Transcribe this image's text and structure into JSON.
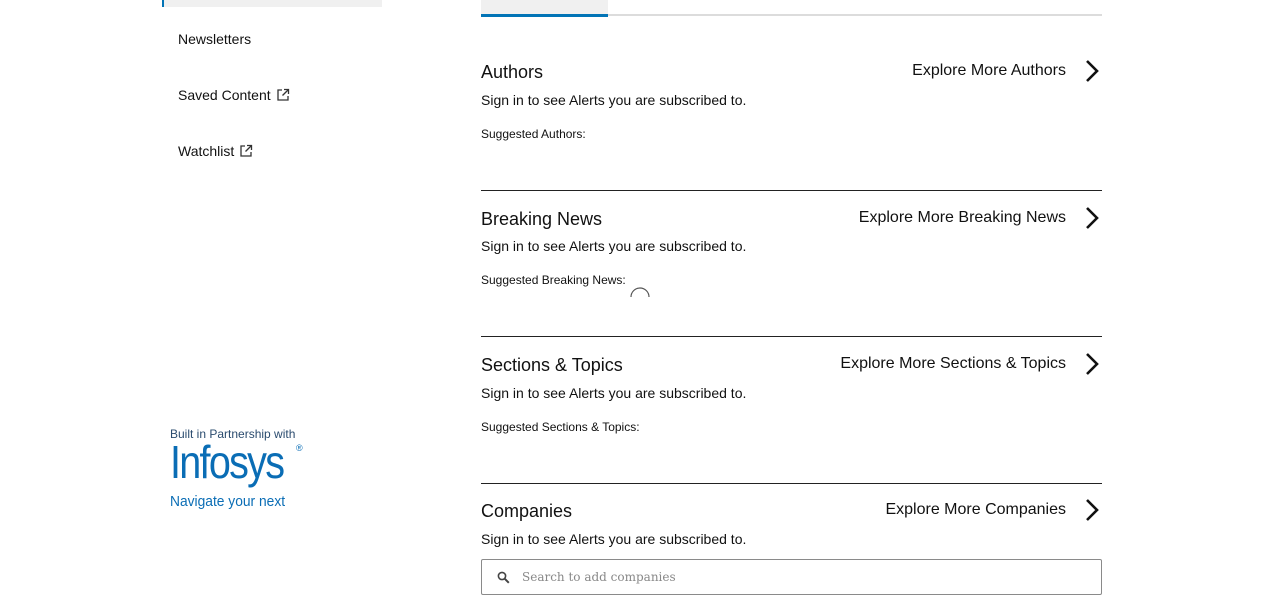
{
  "sidebar": {
    "items": [
      {
        "label": "Newsletters",
        "external": false
      },
      {
        "label": "Saved Content",
        "external": true,
        "icon": "external-link-icon"
      },
      {
        "label": "Watchlist",
        "external": true,
        "icon": "external-link-icon"
      }
    ],
    "partner": {
      "pre_text": "Built in Partnership with",
      "name": "Infosys",
      "registered_mark": "®",
      "tagline": "Navigate your next",
      "brand_color": "#0a6db5"
    }
  },
  "main": {
    "accent_color": "#0274b6",
    "sections": [
      {
        "title": "Authors",
        "explore_label": "Explore More Authors",
        "signin_text": "Sign in to see Alerts you are subscribed to.",
        "suggested_label": "Suggested Authors:"
      },
      {
        "title": "Breaking News",
        "explore_label": "Explore More Breaking News",
        "signin_text": "Sign in to see Alerts you are subscribed to.",
        "suggested_label": "Suggested Breaking News:",
        "loading": true
      },
      {
        "title": "Sections & Topics",
        "explore_label": "Explore More Sections & Topics",
        "signin_text": "Sign in to see Alerts you are subscribed to.",
        "suggested_label": "Suggested Sections & Topics:"
      },
      {
        "title": "Companies",
        "explore_label": "Explore More Companies",
        "signin_text": "Sign in to see Alerts you are subscribed to.",
        "search": {
          "placeholder": "Search to add companies",
          "value": ""
        }
      }
    ]
  }
}
